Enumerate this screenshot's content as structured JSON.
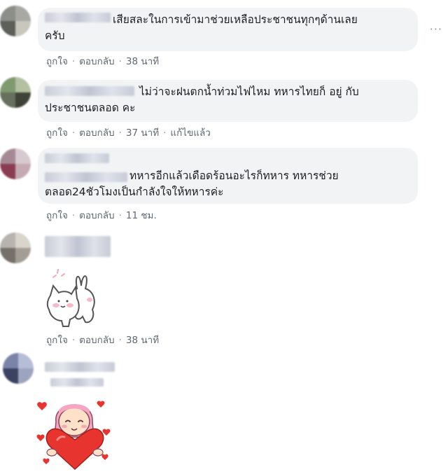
{
  "comments": [
    {
      "text_lines": [
        "เสียสละในการเข้ามาช่วยเหลือประชาชนทุกๆด้านเลย",
        "ครับ"
      ],
      "actions": {
        "like": "ถูกใจ",
        "reply": "ตอบกลับ",
        "time": "38 นาที"
      }
    },
    {
      "text_lines": [
        "ไม่ว่าจะฝนตกน้ำท่วมไฟไหม ทหารไทยก็ อยู่ กับ",
        "ประชาชนตลอด คะ"
      ],
      "actions": {
        "like": "ถูกใจ",
        "reply": "ตอบกลับ",
        "time": "37 นาที",
        "edited": "แก้ไขแล้ว"
      }
    },
    {
      "text_lines": [
        "ทหารอีกแล้วเดือดร้อนอะไรก็ทหาร ทหารช่วย",
        "ตลอด24ชัวโมงเป็นกำลังใจให้ทหารค่ะ"
      ],
      "actions": {
        "like": "ถูกใจ",
        "reply": "ตอบกลับ",
        "time": "11 ชม."
      }
    },
    {
      "sticker": "cat-bunny-hug-sticker",
      "actions": {
        "like": "ถูกใจ",
        "reply": "ตอบกลับ",
        "time": "38 นาที"
      }
    },
    {
      "sticker": "girl-heart-sticker"
    }
  ],
  "more_icon": "more-options-icon",
  "colors": {
    "bubble": "#f2f3f5",
    "meta": "#606770",
    "heart": "#e8342f",
    "hair": "#f6a6c2"
  }
}
